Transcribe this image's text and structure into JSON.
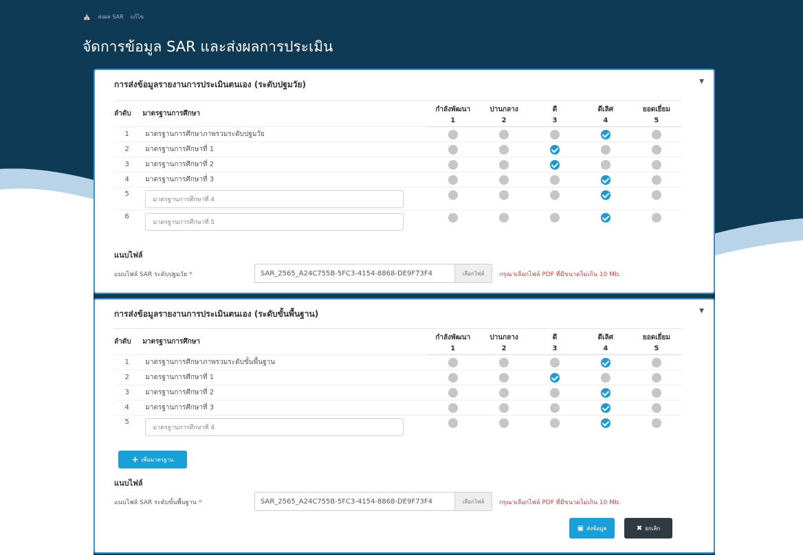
{
  "breadcrumb": {
    "home_icon": "home-icon",
    "items": [
      "ส่งผล SAR",
      "แก้ไข"
    ]
  },
  "page_title": "จัดการข้อมูล SAR และส่งผลการประเมิน",
  "colors": {
    "header_bg": "#0f3a55",
    "accent": "#1aa0d8",
    "check": "#1a9bd8",
    "neutral_dot": "#c6c6c6",
    "danger": "#e53935"
  },
  "levels": [
    {
      "label": "กำลังพัฒนา",
      "num": "1"
    },
    {
      "label": "ปานกลาง",
      "num": "2"
    },
    {
      "label": "ดี",
      "num": "3"
    },
    {
      "label": "ดีเลิศ",
      "num": "4"
    },
    {
      "label": "ยอดเยี่ยม",
      "num": "5"
    }
  ],
  "col_headers": {
    "index": "ลำดับ",
    "standard": "มาตรฐานการศึกษา"
  },
  "section1": {
    "title": "การส่งข้อมูลรายงานการประเมินตนเอง (ระดับปฐมวัย)",
    "rows": [
      {
        "idx": "1",
        "name": "มาตรฐานการศึกษาภาพรวมระดับปฐมวัย",
        "selected": 4
      },
      {
        "idx": "2",
        "name": "มาตรฐานการศึกษาที่ 1",
        "selected": 3
      },
      {
        "idx": "3",
        "name": "มาตรฐานการศึกษาที่ 2",
        "selected": 3
      },
      {
        "idx": "4",
        "name": "มาตรฐานการศึกษาที่ 3",
        "selected": 4
      }
    ],
    "input_rows": [
      {
        "idx": "5",
        "value": "มาตรฐานการศึกษาที่ 4",
        "selected": 4
      },
      {
        "idx": "6",
        "value": "มาตรฐานการศึกษาที่ 5",
        "selected": 4
      }
    ],
    "attach_title": "แนบไฟล์",
    "file_label": "แนบไฟล์ SAR ระดับปฐมวัย",
    "required": "*",
    "file_name": "SAR_2565_A24C755B-5FC3-4154-8868-DE9F73F4",
    "browse_label": "เลือกไฟล์",
    "hint": "กรุณาเลือกไฟล์ PDF ที่มีขนาดไม่เกิน 10 Mb."
  },
  "section2": {
    "title": "การส่งข้อมูลรายงานการประเมินตนเอง (ระดับขั้นพื้นฐาน)",
    "rows": [
      {
        "idx": "1",
        "name": "มาตรฐานการศึกษาภาพรวมระดับขั้นพื้นฐาน",
        "selected": 4
      },
      {
        "idx": "2",
        "name": "มาตรฐานการศึกษาที่ 1",
        "selected": 3
      },
      {
        "idx": "3",
        "name": "มาตรฐานการศึกษาที่ 2",
        "selected": 4
      },
      {
        "idx": "4",
        "name": "มาตรฐานการศึกษาที่ 3",
        "selected": 4
      }
    ],
    "input_rows": [
      {
        "idx": "5",
        "value": "มาตรฐานการศึกษาที่ 4",
        "selected": 4
      }
    ],
    "add_label": "เพิ่มมาตรฐาน",
    "attach_title": "แนบไฟล์",
    "file_label": "แนบไฟล์ SAR ระดับขั้นพื้นฐาน",
    "required": "*",
    "file_name": "SAR_2565_A24C755B-5FC3-4154-8868-DE9F73F4",
    "browse_label": "เลือกไฟล์",
    "hint": "กรุณาเลือกไฟล์ PDF ที่มีขนาดไม่เกิน 10 Mb."
  },
  "actions": {
    "submit_label": "ส่งข้อมูล",
    "cancel_label": "ยกเลิก"
  }
}
